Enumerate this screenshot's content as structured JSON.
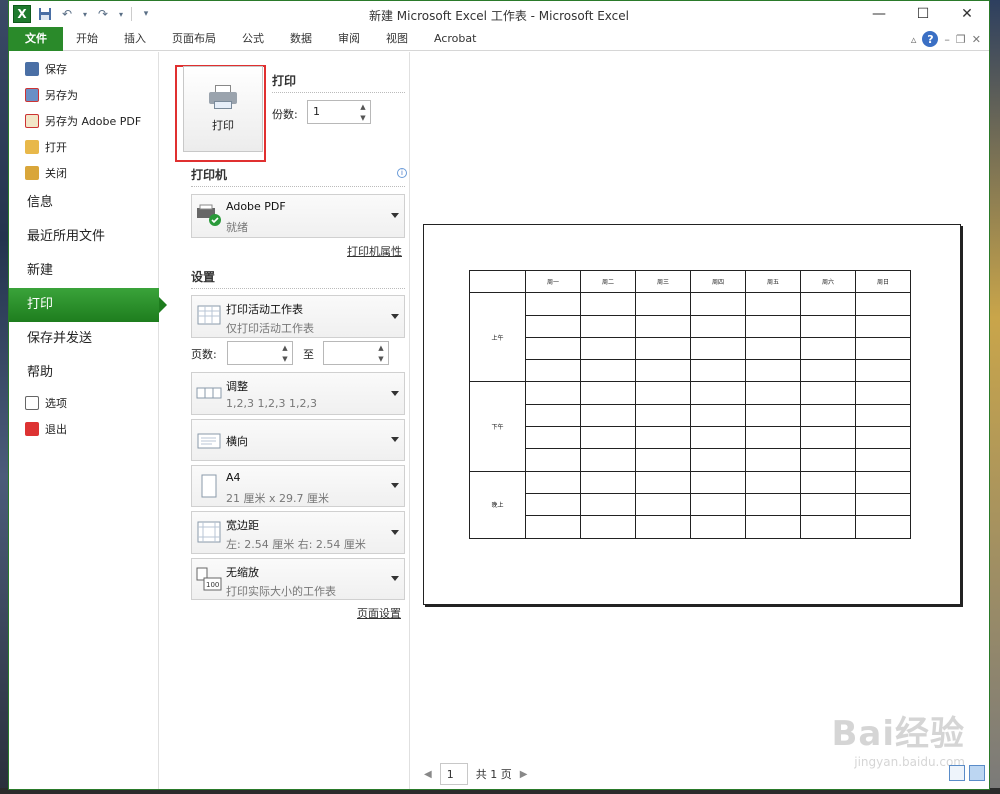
{
  "window": {
    "title": "新建 Microsoft Excel 工作表 - Microsoft Excel",
    "app_icon": "X",
    "minimize": "—",
    "maximize": "☐",
    "close": "✕"
  },
  "ribbon": {
    "tabs": [
      "文件",
      "开始",
      "插入",
      "页面布局",
      "公式",
      "数据",
      "审阅",
      "视图",
      "Acrobat"
    ]
  },
  "backstage_nav": {
    "save": "保存",
    "save_as": "另存为",
    "save_as_pdf": "另存为 Adobe PDF",
    "open": "打开",
    "close": "关闭",
    "info": "信息",
    "recent": "最近所用文件",
    "new": "新建",
    "print": "打印",
    "save_send": "保存并发送",
    "help": "帮助",
    "options": "选项",
    "exit": "退出"
  },
  "print_panel": {
    "print_button": "打印",
    "print_heading": "打印",
    "copies_label": "份数:",
    "copies_value": "1",
    "printer_heading": "打印机",
    "printer_name": "Adobe PDF",
    "printer_status": "就绪",
    "printer_properties": "打印机属性",
    "settings_heading": "设置",
    "scope_main": "打印活动工作表",
    "scope_sub": "仅打印活动工作表",
    "pages_label": "页数:",
    "pages_to": "至",
    "collate_main": "调整",
    "collate_sub": "1,2,3    1,2,3    1,2,3",
    "orientation": "横向",
    "paper_main": "A4",
    "paper_sub": "21 厘米 x 29.7 厘米",
    "margins_main": "宽边距",
    "margins_sub": "左:  2.54 厘米    右:  2.54 厘米",
    "scaling_main": "无缩放",
    "scaling_sub": "打印实际大小的工作表",
    "page_setup": "页面设置",
    "scaling_icon_text": "100"
  },
  "preview": {
    "header_row": [
      "",
      "周一",
      "周二",
      "周三",
      "周四",
      "周五",
      "周六",
      "周日"
    ],
    "groups": [
      "上午",
      "下午",
      "晚上"
    ],
    "page_current": "1",
    "page_total": "共 1 页"
  },
  "watermark": {
    "line1": "Bai经验",
    "line2": "jingyan.baidu.com"
  }
}
